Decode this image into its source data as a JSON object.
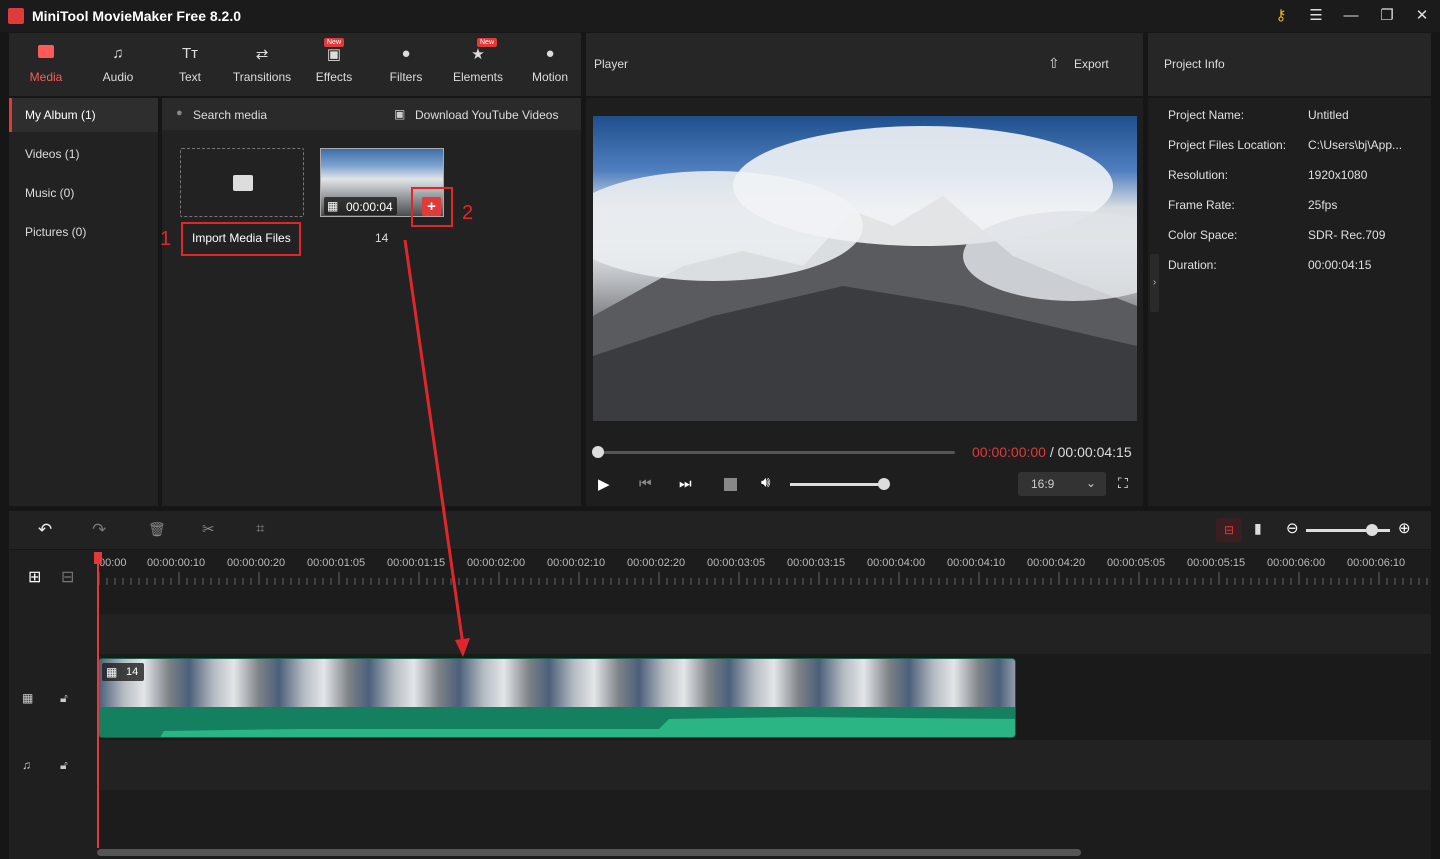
{
  "app": {
    "title": "MiniTool MovieMaker Free 8.2.0"
  },
  "toolbar": {
    "tabs": [
      {
        "label": "Media",
        "icon": "media-icon",
        "glyph": "▬"
      },
      {
        "label": "Audio",
        "icon": "music-note-icon",
        "glyph": "♫"
      },
      {
        "label": "Text",
        "icon": "text-icon",
        "glyph": "Tт"
      },
      {
        "label": "Transitions",
        "icon": "transitions-icon",
        "glyph": "⇄"
      },
      {
        "label": "Effects",
        "icon": "effects-icon",
        "glyph": "▣",
        "badge": "New"
      },
      {
        "label": "Filters",
        "icon": "filters-icon",
        "glyph": "●"
      },
      {
        "label": "Elements",
        "icon": "elements-icon",
        "glyph": "★",
        "badge": "New"
      },
      {
        "label": "Motion",
        "icon": "motion-icon",
        "glyph": "●"
      }
    ]
  },
  "sidebar": {
    "items": [
      {
        "label": "My Album (1)"
      },
      {
        "label": "Videos (1)"
      },
      {
        "label": "Music (0)"
      },
      {
        "label": "Pictures (0)"
      }
    ]
  },
  "media": {
    "search_placeholder": "Search media",
    "download_label": "Download YouTube Videos",
    "import_label": "Import Media Files",
    "clip_duration": "00:00:04",
    "clip_name": "14",
    "callout_1": "1",
    "callout_2": "2"
  },
  "player": {
    "title": "Player",
    "export_label": "Export",
    "time_current": "00:00:00:00",
    "time_separator": " / ",
    "time_total": "00:00:04:15",
    "aspect": "16:9",
    "progress": 0,
    "volume": 1.0
  },
  "project_info": {
    "title": "Project Info",
    "rows": [
      {
        "key": "Project Name:",
        "value": "Untitled"
      },
      {
        "key": "Project Files Location:",
        "value": "C:\\Users\\bj\\App..."
      },
      {
        "key": "Resolution:",
        "value": "1920x1080"
      },
      {
        "key": "Frame Rate:",
        "value": "25fps"
      },
      {
        "key": "Color Space:",
        "value": "SDR- Rec.709"
      },
      {
        "key": "Duration:",
        "value": "00:00:04:15"
      }
    ]
  },
  "timeline": {
    "ruler": [
      "00:00",
      "00:00:00:10",
      "00:00:00:20",
      "00:00:01:05",
      "00:00:01:15",
      "00:00:02:00",
      "00:00:02:10",
      "00:00:02:20",
      "00:00:03:05",
      "00:00:03:15",
      "00:00:04:00",
      "00:00:04:10",
      "00:00:04:20",
      "00:00:05:05",
      "00:00:05:15",
      "00:00:06:00",
      "00:00:06:10"
    ],
    "clip_label": "14",
    "zoom": 0.78
  },
  "colors": {
    "accent": "#e03a3a",
    "audio_wave": "#2bb585",
    "clip_bg": "#14805f"
  }
}
